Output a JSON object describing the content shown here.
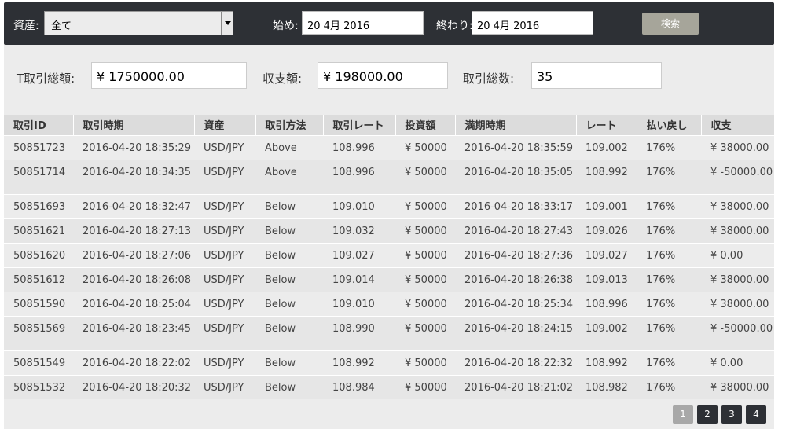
{
  "filter": {
    "asset_label": "資産:",
    "asset_value": "全て",
    "start_label": "始め:",
    "start_value": "20 4月 2016",
    "end_label": "終わり:",
    "end_value": "20 4月 2016",
    "search_label": "検索"
  },
  "summary": {
    "total_amount_label": "T取引総額:",
    "total_amount_value": "¥ 1750000.00",
    "balance_label": "収支額:",
    "balance_value": "¥ 198000.00",
    "count_label": "取引総数:",
    "count_value": "35"
  },
  "table": {
    "headers": [
      "取引ID",
      "取引時期",
      "資産",
      "取引方法",
      "取引レート",
      "投資額",
      "満期時期",
      "レート",
      "払い戻し",
      "収支"
    ],
    "rows": [
      [
        "50851723",
        "2016-04-20 18:35:29",
        "USD/JPY",
        "Above",
        "108.996",
        "¥ 50000",
        "2016-04-20 18:35:59",
        "109.002",
        "176%",
        "¥ 38000.00"
      ],
      [
        "50851714",
        "2016-04-20 18:34:35",
        "USD/JPY",
        "Above",
        "108.996",
        "¥ 50000",
        "2016-04-20 18:35:05",
        "108.992",
        "176%",
        "¥ -50000.00"
      ],
      [
        "50851693",
        "2016-04-20 18:32:47",
        "USD/JPY",
        "Below",
        "109.010",
        "¥ 50000",
        "2016-04-20 18:33:17",
        "109.001",
        "176%",
        "¥ 38000.00"
      ],
      [
        "50851621",
        "2016-04-20 18:27:13",
        "USD/JPY",
        "Below",
        "109.032",
        "¥ 50000",
        "2016-04-20 18:27:43",
        "109.026",
        "176%",
        "¥ 38000.00"
      ],
      [
        "50851620",
        "2016-04-20 18:27:06",
        "USD/JPY",
        "Below",
        "109.027",
        "¥ 50000",
        "2016-04-20 18:27:36",
        "109.027",
        "176%",
        "¥ 0.00"
      ],
      [
        "50851612",
        "2016-04-20 18:26:08",
        "USD/JPY",
        "Below",
        "109.014",
        "¥ 50000",
        "2016-04-20 18:26:38",
        "109.013",
        "176%",
        "¥ 38000.00"
      ],
      [
        "50851590",
        "2016-04-20 18:25:04",
        "USD/JPY",
        "Below",
        "109.010",
        "¥ 50000",
        "2016-04-20 18:25:34",
        "108.996",
        "176%",
        "¥ 38000.00"
      ],
      [
        "50851569",
        "2016-04-20 18:23:45",
        "USD/JPY",
        "Below",
        "108.990",
        "¥ 50000",
        "2016-04-20 18:24:15",
        "109.002",
        "176%",
        "¥ -50000.00"
      ],
      [
        "50851549",
        "2016-04-20 18:22:02",
        "USD/JPY",
        "Below",
        "108.992",
        "¥ 50000",
        "2016-04-20 18:22:32",
        "108.992",
        "176%",
        "¥ 0.00"
      ],
      [
        "50851532",
        "2016-04-20 18:20:32",
        "USD/JPY",
        "Below",
        "108.984",
        "¥ 50000",
        "2016-04-20 18:21:02",
        "108.982",
        "176%",
        "¥ 38000.00"
      ]
    ]
  },
  "pagination": {
    "pages": [
      "1",
      "2",
      "3",
      "4"
    ],
    "active": "1"
  }
}
